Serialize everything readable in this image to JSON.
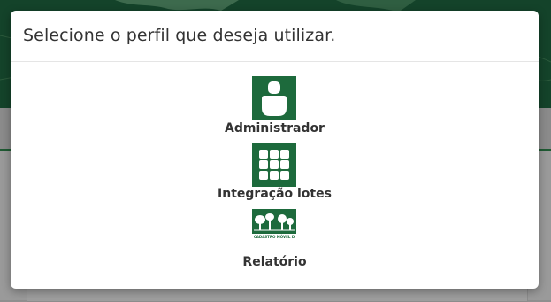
{
  "modal": {
    "title": "Selecione o perfil que deseja utilizar.",
    "profiles": [
      {
        "label": "Administrador",
        "icon": "user-icon"
      },
      {
        "label": "Integração lotes",
        "icon": "grid-icon"
      },
      {
        "label": "Relatório",
        "icon": "forest-logo",
        "logo_text": "CADASTRO MÓVEL D"
      }
    ]
  },
  "colors": {
    "brand_green": "#1d6a3c",
    "header_dark_green": "#14432a",
    "overlay_gray": "#8f8f8f"
  }
}
